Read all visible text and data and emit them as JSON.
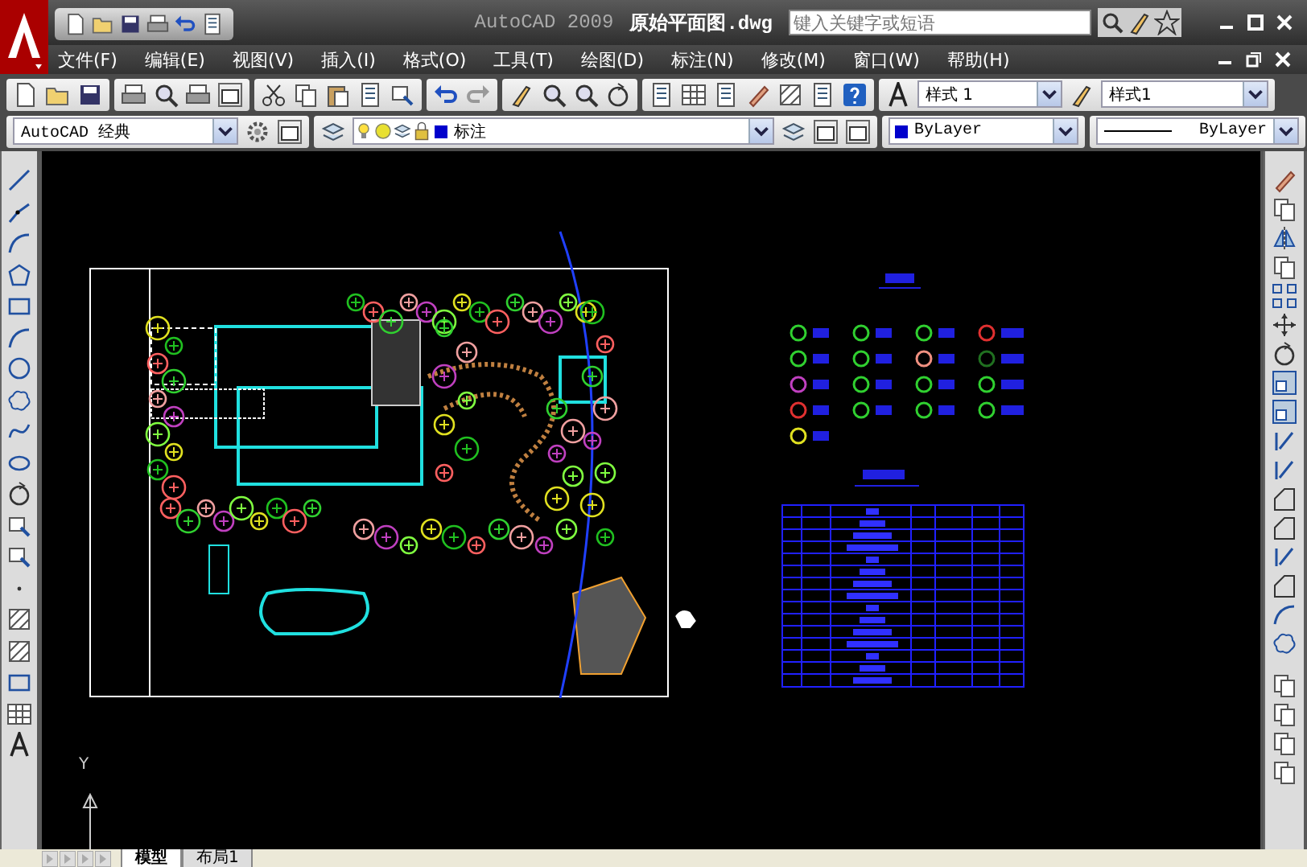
{
  "window": {
    "app_title": "AutoCAD 2009",
    "file_title": "原始平面图.dwg",
    "search": {
      "placeholder": "键入关键字或短语"
    }
  },
  "menu": [
    "文件(F)",
    "编辑(E)",
    "视图(V)",
    "插入(I)",
    "格式(O)",
    "工具(T)",
    "绘图(D)",
    "标注(N)",
    "修改(M)",
    "窗口(W)",
    "帮助(H)"
  ],
  "styles_toolbar": {
    "text_style": "样式 1",
    "dim_style": "样式1"
  },
  "properties_toolbar": {
    "workspace": "AutoCAD 经典",
    "layer": "标注",
    "color_setting": "ByLayer",
    "linetype": "ByLayer"
  },
  "ucs": {
    "axis": "Y"
  },
  "tabs": [
    {
      "label": "模型",
      "selected": true
    },
    {
      "label": "布局1",
      "selected": false
    }
  ]
}
